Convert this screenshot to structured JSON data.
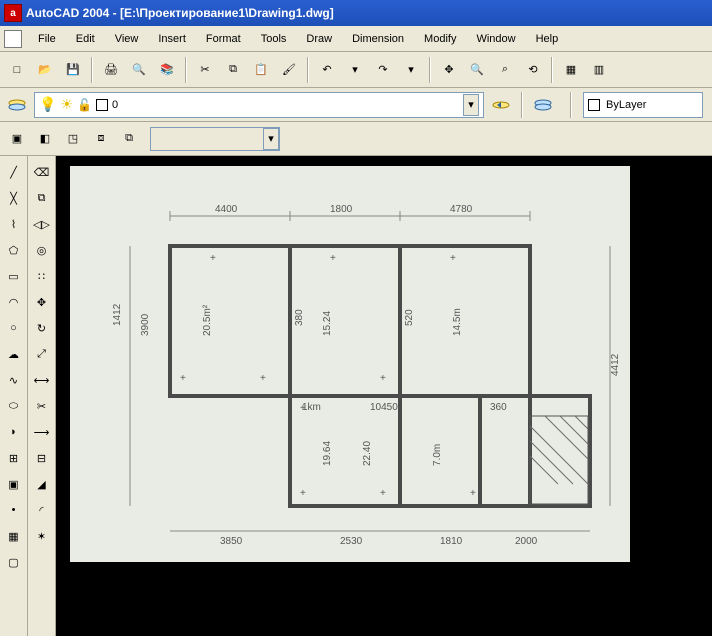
{
  "title": "AutoCAD 2004 - [E:\\Проектирование1\\Drawing1.dwg]",
  "app_icon_letter": "a",
  "menu": [
    "File",
    "Edit",
    "View",
    "Insert",
    "Format",
    "Tools",
    "Draw",
    "Dimension",
    "Modify",
    "Window",
    "Help"
  ],
  "layer": {
    "current": "0",
    "bulb": "on",
    "sun": "on",
    "lock": "unlocked",
    "color": "#ffffff"
  },
  "bylayer": {
    "label": "ByLayer",
    "swatch": "#ffffff"
  },
  "std_toolbar": [
    {
      "name": "new-icon",
      "glyph": "□"
    },
    {
      "name": "open-icon",
      "glyph": "📂"
    },
    {
      "name": "save-icon",
      "glyph": "💾"
    },
    {
      "sep": true
    },
    {
      "name": "print-icon",
      "glyph": "🖨"
    },
    {
      "name": "preview-icon",
      "glyph": "🔍"
    },
    {
      "name": "publish-icon",
      "glyph": "📚"
    },
    {
      "sep": true
    },
    {
      "name": "cut-icon",
      "glyph": "✂"
    },
    {
      "name": "copy-icon",
      "glyph": "⧉"
    },
    {
      "name": "paste-icon",
      "glyph": "📋"
    },
    {
      "name": "match-icon",
      "glyph": "🖌"
    },
    {
      "sep": true
    },
    {
      "name": "undo-icon",
      "glyph": "↶"
    },
    {
      "name": "undo-dd-icon",
      "glyph": "▾"
    },
    {
      "name": "redo-icon",
      "glyph": "↷"
    },
    {
      "name": "redo-dd-icon",
      "glyph": "▾"
    },
    {
      "sep": true
    },
    {
      "name": "pan-icon",
      "glyph": "✥"
    },
    {
      "name": "zoom-rt-icon",
      "glyph": "🔍"
    },
    {
      "name": "zoom-win-icon",
      "glyph": "⌕"
    },
    {
      "name": "zoom-prev-icon",
      "glyph": "⟲"
    },
    {
      "sep": true
    },
    {
      "name": "properties-icon",
      "glyph": "▦"
    },
    {
      "name": "design-center-icon",
      "glyph": "▥"
    }
  ],
  "toolbar2": [
    {
      "name": "make-block-icon",
      "glyph": "▣"
    },
    {
      "name": "insert-block-icon",
      "glyph": "◧"
    },
    {
      "name": "ledge-icon",
      "glyph": "◳"
    },
    {
      "name": "group-icon",
      "glyph": "⧈"
    },
    {
      "name": "ungroup-icon",
      "glyph": "⧉"
    }
  ],
  "draw_tools": [
    {
      "name": "line-icon",
      "glyph": "╱"
    },
    {
      "name": "xline-icon",
      "glyph": "╳"
    },
    {
      "name": "polyline-icon",
      "glyph": "⌇"
    },
    {
      "name": "polygon-icon",
      "glyph": "⬠"
    },
    {
      "name": "rectangle-icon",
      "glyph": "▭"
    },
    {
      "name": "arc-icon",
      "glyph": "◠"
    },
    {
      "name": "circle-icon",
      "glyph": "○"
    },
    {
      "name": "revcloud-icon",
      "glyph": "☁"
    },
    {
      "name": "spline-icon",
      "glyph": "∿"
    },
    {
      "name": "ellipse-icon",
      "glyph": "⬭"
    },
    {
      "name": "ellipse-arc-icon",
      "glyph": "◗"
    },
    {
      "name": "insert-icon",
      "glyph": "⊞"
    },
    {
      "name": "make-block2-icon",
      "glyph": "▣"
    },
    {
      "name": "point-icon",
      "glyph": "•"
    },
    {
      "name": "hatch-icon",
      "glyph": "▦"
    },
    {
      "name": "region-icon",
      "glyph": "▢"
    }
  ],
  "modify_tools": [
    {
      "name": "erase-icon",
      "glyph": "⌫"
    },
    {
      "name": "copy-obj-icon",
      "glyph": "⧉"
    },
    {
      "name": "mirror-icon",
      "glyph": "◁▷"
    },
    {
      "name": "offset-icon",
      "glyph": "◎"
    },
    {
      "name": "array-icon",
      "glyph": "∷"
    },
    {
      "name": "move-icon",
      "glyph": "✥"
    },
    {
      "name": "rotate-icon",
      "glyph": "↻"
    },
    {
      "name": "scale-icon",
      "glyph": "⤢"
    },
    {
      "name": "stretch-icon",
      "glyph": "⟷"
    },
    {
      "name": "trim-icon",
      "glyph": "✂"
    },
    {
      "name": "extend-icon",
      "glyph": "⟶"
    },
    {
      "name": "break-icon",
      "glyph": "⊟"
    },
    {
      "name": "chamfer-icon",
      "glyph": "◢"
    },
    {
      "name": "fillet-icon",
      "glyph": "◜"
    },
    {
      "name": "explode-icon",
      "glyph": "✶"
    }
  ],
  "sketch": {
    "top_dims": [
      "4400",
      "1800",
      "4780"
    ],
    "left_dims": [
      "1412",
      "3900"
    ],
    "right_dims": [
      "4412"
    ],
    "bottom_dims": [
      "3850",
      "2530",
      "1810",
      "2000"
    ],
    "room_labels": [
      "20.5m²",
      "15.24",
      "14.5m",
      "19.64",
      "22.40",
      "7.0m"
    ],
    "inner": [
      "380",
      "520",
      "1km",
      "10450",
      "360"
    ]
  }
}
